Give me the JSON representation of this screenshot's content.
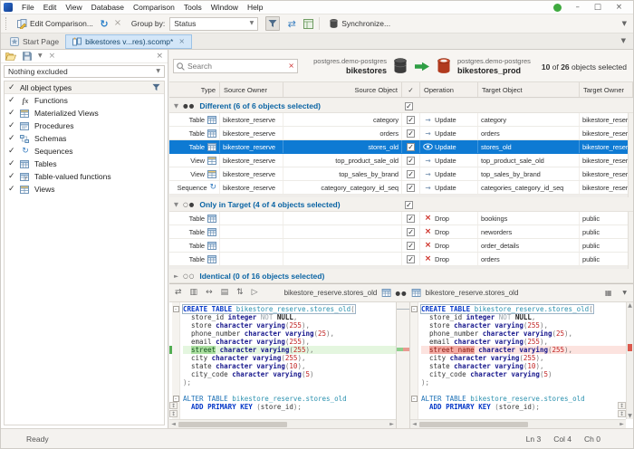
{
  "menu": {
    "items": [
      "File",
      "Edit",
      "View",
      "Database",
      "Comparison",
      "Tools",
      "Window",
      "Help"
    ]
  },
  "toolbar": {
    "edit_comparison_label": "Edit Comparison...",
    "group_by_label": "Group by:",
    "group_by_value": "Status",
    "synchronize_label": "Synchronize..."
  },
  "tabs": {
    "start_page_label": "Start Page",
    "active_tab_label": "bikestores v...res).scomp*"
  },
  "filter_panel": {
    "exclude_combo_value": "Nothing excluded",
    "all_types_label": "All object types",
    "types": [
      "Functions",
      "Materialized Views",
      "Procedures",
      "Schemas",
      "Sequences",
      "Tables",
      "Table-valued functions",
      "Views"
    ]
  },
  "comparison": {
    "search_placeholder": "Search",
    "source_server": "postgres.demo-postgres",
    "source_database": "bikestores",
    "target_server": "postgres.demo-postgres",
    "target_database": "bikestores_prod",
    "summary": {
      "selected": "10",
      "of": "of",
      "total": "26",
      "suffix": "objects selected"
    },
    "columns": [
      "Type",
      "Source Owner",
      "Source Object",
      "✓",
      "Operation",
      "Target Object",
      "Target Owner"
    ],
    "colors": {
      "selection": "#0e7ad3",
      "group_text": "#0a64a4",
      "source_db": "#3d3d3d",
      "target_db": "#b13a1e",
      "arrow": "#2f9e44",
      "drop": "#cc2a21"
    },
    "groups": [
      {
        "label": "Different (6 of 6 objects selected)",
        "expanded": true,
        "dots": [
          "filled",
          "filled"
        ],
        "checked": true,
        "rows": [
          {
            "type": "Table",
            "type_icon": "table",
            "source_owner": "bikestore_reserve",
            "source_object": "category",
            "checked": true,
            "operation": "Update",
            "op_icon": "arrow",
            "target_object": "category",
            "target_owner": "bikestore_reserve",
            "selected": false
          },
          {
            "type": "Table",
            "type_icon": "table",
            "source_owner": "bikestore_reserve",
            "source_object": "orders",
            "checked": true,
            "operation": "Update",
            "op_icon": "arrow",
            "target_object": "orders",
            "target_owner": "bikestore_reserve",
            "selected": false
          },
          {
            "type": "Table",
            "type_icon": "table",
            "source_owner": "bikestore_reserve",
            "source_object": "stores_old",
            "checked": true,
            "operation": "Update",
            "op_icon": "eye",
            "target_object": "stores_old",
            "target_owner": "bikestore_reserve",
            "selected": true
          },
          {
            "type": "View",
            "type_icon": "view",
            "source_owner": "bikestore_reserve",
            "source_object": "top_product_sale_old",
            "checked": true,
            "operation": "Update",
            "op_icon": "arrow",
            "target_object": "top_product_sale_old",
            "target_owner": "bikestore_reserve",
            "selected": false
          },
          {
            "type": "View",
            "type_icon": "view",
            "source_owner": "bikestore_reserve",
            "source_object": "top_sales_by_brand",
            "checked": true,
            "operation": "Update",
            "op_icon": "arrow",
            "target_object": "top_sales_by_brand",
            "target_owner": "bikestore_reserve",
            "selected": false
          },
          {
            "type": "Sequence",
            "type_icon": "sequence",
            "source_owner": "bikestore_reserve",
            "source_object": "category_category_id_seq",
            "checked": true,
            "operation": "Update",
            "op_icon": "arrow",
            "target_object": "categories_category_id_seq",
            "target_owner": "bikestore_reserve",
            "selected": false
          }
        ]
      },
      {
        "label": "Only in Target (4 of 4 objects selected)",
        "expanded": true,
        "dots": [
          "outline",
          "filled"
        ],
        "checked": true,
        "rows": [
          {
            "type": "Table",
            "type_icon": "table",
            "source_owner": "",
            "source_object": "",
            "checked": true,
            "operation": "Drop",
            "op_icon": "cross",
            "target_object": "bookings",
            "target_owner": "public",
            "selected": false
          },
          {
            "type": "Table",
            "type_icon": "table",
            "source_owner": "",
            "source_object": "",
            "checked": true,
            "operation": "Drop",
            "op_icon": "cross",
            "target_object": "neworders",
            "target_owner": "public",
            "selected": false
          },
          {
            "type": "Table",
            "type_icon": "table",
            "source_owner": "",
            "source_object": "",
            "checked": true,
            "operation": "Drop",
            "op_icon": "cross",
            "target_object": "order_details",
            "target_owner": "public",
            "selected": false
          },
          {
            "type": "Table",
            "type_icon": "table",
            "source_owner": "",
            "source_object": "",
            "checked": true,
            "operation": "Drop",
            "op_icon": "cross",
            "target_object": "orders",
            "target_owner": "public",
            "selected": false
          }
        ]
      },
      {
        "label": "Identical (0 of 16 objects selected)",
        "expanded": false,
        "dots": [
          "outline",
          "outline"
        ],
        "checked": null,
        "rows": []
      }
    ]
  },
  "diff": {
    "left_object": "bikestore_reserve.stores_old",
    "right_object": "bikestore_reserve.stores_old",
    "left_lines": [
      {
        "b": 1,
        "f": 1,
        "t": [
          [
            "kb",
            "CREATE TABLE "
          ],
          [
            "o",
            "bikestore_reserve.stores_old"
          ],
          [
            "p",
            "("
          ]
        ]
      },
      {
        "t": [
          [
            "i",
            "  store_id "
          ],
          [
            "t2",
            "integer "
          ],
          [
            "g",
            "NOT "
          ],
          [
            "bd",
            "NULL"
          ],
          [
            "p",
            ","
          ]
        ]
      },
      {
        "t": [
          [
            "i",
            "  store "
          ],
          [
            "t2",
            "character varying"
          ],
          [
            "p",
            "("
          ],
          [
            "n",
            "255"
          ],
          [
            "p",
            "),"
          ]
        ]
      },
      {
        "t": [
          [
            "i",
            "  phone_number "
          ],
          [
            "t2",
            "character varying"
          ],
          [
            "p",
            "("
          ],
          [
            "n",
            "25"
          ],
          [
            "p",
            "),"
          ]
        ]
      },
      {
        "t": [
          [
            "i",
            "  email "
          ],
          [
            "t2",
            "character varying"
          ],
          [
            "p",
            "("
          ],
          [
            "n",
            "255"
          ],
          [
            "p",
            "),"
          ]
        ]
      },
      {
        "c": "add",
        "t": [
          [
            "i",
            "  "
          ],
          [
            "dw",
            "street"
          ],
          [
            "i",
            " "
          ],
          [
            "t2",
            "character varying"
          ],
          [
            "p",
            "("
          ],
          [
            "n",
            "255"
          ],
          [
            "p",
            "),"
          ]
        ]
      },
      {
        "t": [
          [
            "i",
            "  city "
          ],
          [
            "t2",
            "character varying"
          ],
          [
            "p",
            "("
          ],
          [
            "n",
            "255"
          ],
          [
            "p",
            "),"
          ]
        ]
      },
      {
        "t": [
          [
            "i",
            "  state "
          ],
          [
            "t2",
            "character varying"
          ],
          [
            "p",
            "("
          ],
          [
            "n",
            "10"
          ],
          [
            "p",
            "),"
          ]
        ]
      },
      {
        "t": [
          [
            "i",
            "  city_code "
          ],
          [
            "t2",
            "character varying"
          ],
          [
            "p",
            "("
          ],
          [
            "n",
            "5"
          ],
          [
            "p",
            ")"
          ]
        ]
      },
      {
        "t": [
          [
            "p",
            ");"
          ]
        ]
      },
      {
        "t": []
      },
      {
        "f": 1,
        "t": [
          [
            "k",
            "ALTER TABLE "
          ],
          [
            "o",
            "bikestore_reserve.stores_old"
          ]
        ]
      },
      {
        "t": [
          [
            "kb",
            "  ADD PRIMARY KEY "
          ],
          [
            "p",
            "("
          ],
          [
            "i",
            "store_id"
          ],
          [
            "p",
            ");"
          ]
        ]
      }
    ],
    "right_lines": [
      {
        "b": 1,
        "f": 1,
        "t": [
          [
            "kb",
            "CREATE TABLE "
          ],
          [
            "o",
            "bikestore_reserve.stores_old"
          ],
          [
            "p",
            "("
          ]
        ]
      },
      {
        "t": [
          [
            "i",
            "  store_id "
          ],
          [
            "t2",
            "integer "
          ],
          [
            "g",
            "NOT "
          ],
          [
            "bd",
            "NULL"
          ],
          [
            "p",
            ","
          ]
        ]
      },
      {
        "t": [
          [
            "i",
            "  store "
          ],
          [
            "t2",
            "character varying"
          ],
          [
            "p",
            "("
          ],
          [
            "n",
            "255"
          ],
          [
            "p",
            "),"
          ]
        ]
      },
      {
        "t": [
          [
            "i",
            "  phone_number "
          ],
          [
            "t2",
            "character varying"
          ],
          [
            "p",
            "("
          ],
          [
            "n",
            "25"
          ],
          [
            "p",
            "),"
          ]
        ]
      },
      {
        "t": [
          [
            "i",
            "  email "
          ],
          [
            "t2",
            "character varying"
          ],
          [
            "p",
            "("
          ],
          [
            "n",
            "255"
          ],
          [
            "p",
            "),"
          ]
        ]
      },
      {
        "c": "del",
        "t": [
          [
            "i",
            "  "
          ],
          [
            "dw",
            "street_name"
          ],
          [
            "i",
            " "
          ],
          [
            "t2",
            "character varying"
          ],
          [
            "p",
            "("
          ],
          [
            "n",
            "255"
          ],
          [
            "p",
            "),"
          ]
        ]
      },
      {
        "t": [
          [
            "i",
            "  city "
          ],
          [
            "t2",
            "character varying"
          ],
          [
            "p",
            "("
          ],
          [
            "n",
            "255"
          ],
          [
            "p",
            "),"
          ]
        ]
      },
      {
        "t": [
          [
            "i",
            "  state "
          ],
          [
            "t2",
            "character varying"
          ],
          [
            "p",
            "("
          ],
          [
            "n",
            "10"
          ],
          [
            "p",
            "),"
          ]
        ]
      },
      {
        "t": [
          [
            "i",
            "  city_code "
          ],
          [
            "t2",
            "character varying"
          ],
          [
            "p",
            "("
          ],
          [
            "n",
            "5"
          ],
          [
            "p",
            ")"
          ]
        ]
      },
      {
        "t": [
          [
            "p",
            ");"
          ]
        ]
      },
      {
        "t": []
      },
      {
        "f": 1,
        "t": [
          [
            "k",
            "ALTER TABLE "
          ],
          [
            "o",
            "bikestore_reserve.stores_old"
          ]
        ]
      },
      {
        "t": [
          [
            "kb",
            "  ADD PRIMARY KEY "
          ],
          [
            "p",
            "("
          ],
          [
            "i",
            "store_id"
          ],
          [
            "p",
            ");"
          ]
        ]
      }
    ]
  },
  "statusbar": {
    "message": "Ready",
    "line": "Ln 3",
    "column": "Col 4",
    "character": "Ch 0"
  }
}
